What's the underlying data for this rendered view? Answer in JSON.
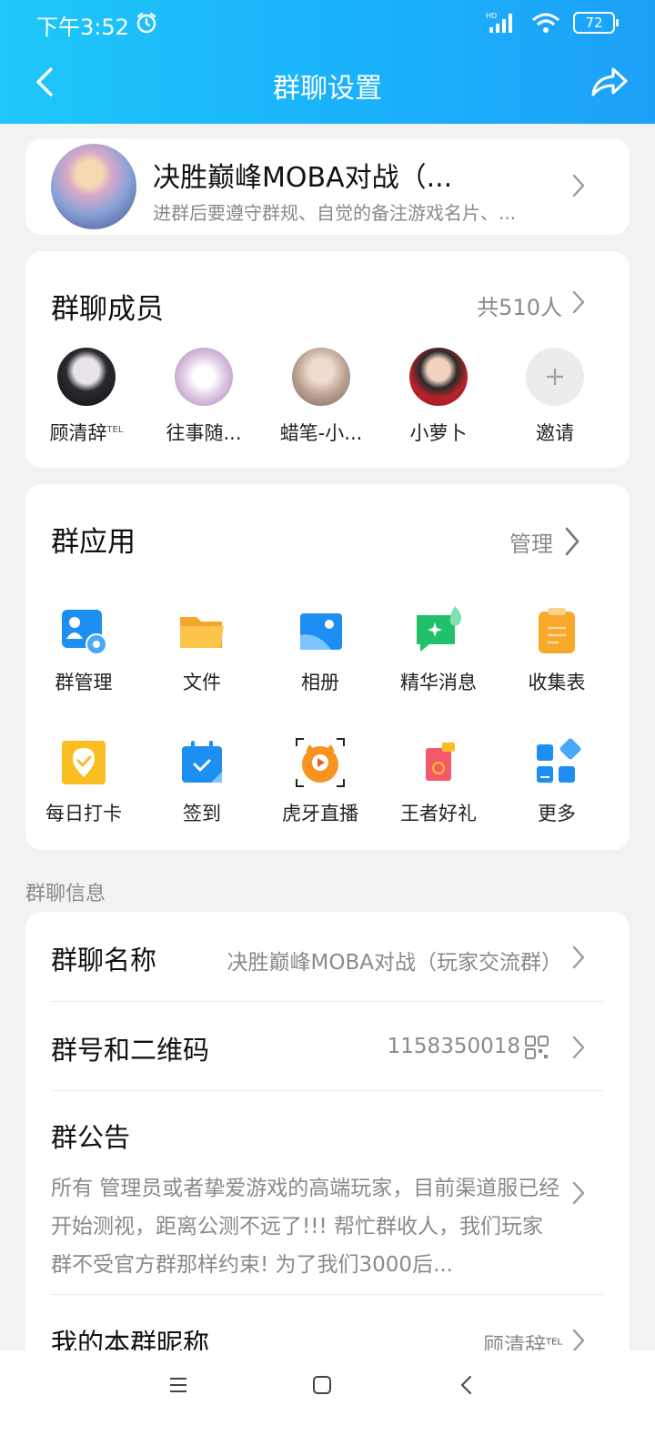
{
  "status_bar": {
    "time": "下午3:52",
    "battery": "72"
  },
  "header": {
    "title": "群聊设置"
  },
  "group": {
    "name": "决胜巅峰MOBA对战（...",
    "description": "进群后要遵守群规、自觉的备注游戏名片、..."
  },
  "members": {
    "title": "群聊成员",
    "count": "共510人",
    "list": [
      {
        "name": "顾清辞",
        "badge": "TEL"
      },
      {
        "name": "往事随..."
      },
      {
        "name": "蜡笔-小..."
      },
      {
        "name": "小萝卜"
      },
      {
        "name": "邀请"
      }
    ]
  },
  "apps": {
    "title": "群应用",
    "manage": "管理",
    "items": [
      {
        "label": "群管理",
        "icon": "group-manage-icon"
      },
      {
        "label": "文件",
        "icon": "folder-icon"
      },
      {
        "label": "相册",
        "icon": "album-icon"
      },
      {
        "label": "精华消息",
        "icon": "essence-icon"
      },
      {
        "label": "收集表",
        "icon": "clipboard-icon"
      },
      {
        "label": "每日打卡",
        "icon": "checkin-icon"
      },
      {
        "label": "签到",
        "icon": "calendar-icon"
      },
      {
        "label": "虎牙直播",
        "icon": "huya-icon"
      },
      {
        "label": "王者好礼",
        "icon": "gift-icon"
      },
      {
        "label": "更多",
        "icon": "more-apps-icon"
      }
    ]
  },
  "info": {
    "caption": "群聊信息",
    "name_label": "群聊名称",
    "name_value": "决胜巅峰MOBA对战（玩家交流群）",
    "number_label": "群号和二维码",
    "number_value": "1158350018",
    "notice_label": "群公告",
    "notice_text": "所有 管理员或者挚爱游戏的高端玩家，目前渠道服已经开始测视，距离公测不远了!!! 帮忙群收人，我们玩家群不受官方群那样约束! 为了我们3000后...",
    "nickname_label": "我的本群昵称",
    "nickname_value": "顾清辞",
    "nickname_badge": "TEL"
  },
  "colors": {
    "header_gradient_start": "#1fc8f9",
    "header_gradient_end": "#1da1f8",
    "app_blue": "#1e8ff2"
  }
}
